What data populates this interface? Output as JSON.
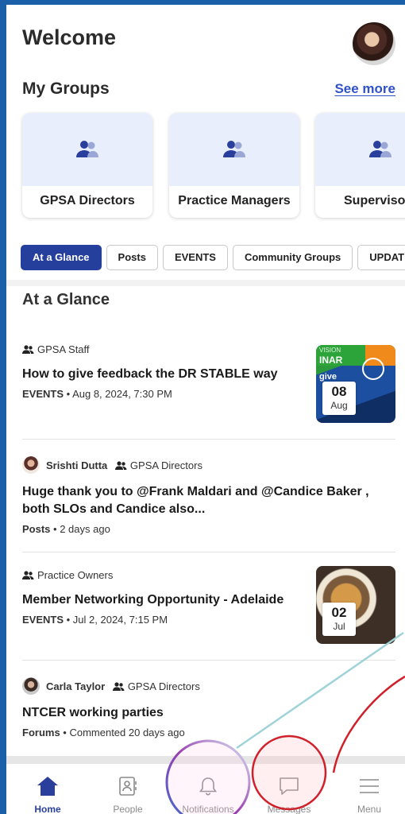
{
  "header": {
    "title": "Welcome"
  },
  "groups_section": {
    "title": "My Groups",
    "see_more": "See more",
    "groups": [
      {
        "name": "GPSA Directors"
      },
      {
        "name": "Practice Managers"
      },
      {
        "name": "Superviso"
      }
    ]
  },
  "tabs": [
    {
      "label": "At a Glance",
      "active": true
    },
    {
      "label": "Posts"
    },
    {
      "label": "EVENTS"
    },
    {
      "label": "Community Groups"
    },
    {
      "label": "UPDAT"
    }
  ],
  "feed": {
    "title": "At a Glance",
    "items": [
      {
        "group": "GPSA Staff",
        "title": "How to give feedback the DR STABLE way",
        "type": "EVENTS",
        "time": "• Aug 8, 2024, 7:30 PM",
        "date_day": "08",
        "date_month": "Aug",
        "thumb_top": "VISION",
        "thumb_banner": "INAR",
        "thumb_give": "give"
      },
      {
        "author": "Srishti Dutta",
        "group": "GPSA Directors",
        "title": "Huge thank you to @Frank Maldari and @Candice Baker , both SLOs and Candice also...",
        "type": "Posts",
        "time": "• 2 days ago"
      },
      {
        "group": "Practice Owners",
        "title": "Member Networking Opportunity - Adelaide",
        "type": "EVENTS",
        "time": "• Jul 2, 2024, 7:15 PM",
        "date_day": "02",
        "date_month": "Jul"
      },
      {
        "author": "Carla Taylor",
        "group": "GPSA Directors",
        "title": "NTCER working parties",
        "type": "Forums",
        "time": "• Commented 20 days ago"
      }
    ]
  },
  "bottom_nav": [
    {
      "label": "Home",
      "icon": "home-icon",
      "active": true
    },
    {
      "label": "People",
      "icon": "people-card-icon"
    },
    {
      "label": "Notifications",
      "icon": "bell-icon"
    },
    {
      "label": "Messages",
      "icon": "chat-icon"
    },
    {
      "label": "Menu",
      "icon": "menu-icon"
    }
  ],
  "colors": {
    "accent": "#243f9c",
    "link": "#2f52c9",
    "group_card_bg": "#e8eefb",
    "frame_border": "#1a5fa8"
  }
}
